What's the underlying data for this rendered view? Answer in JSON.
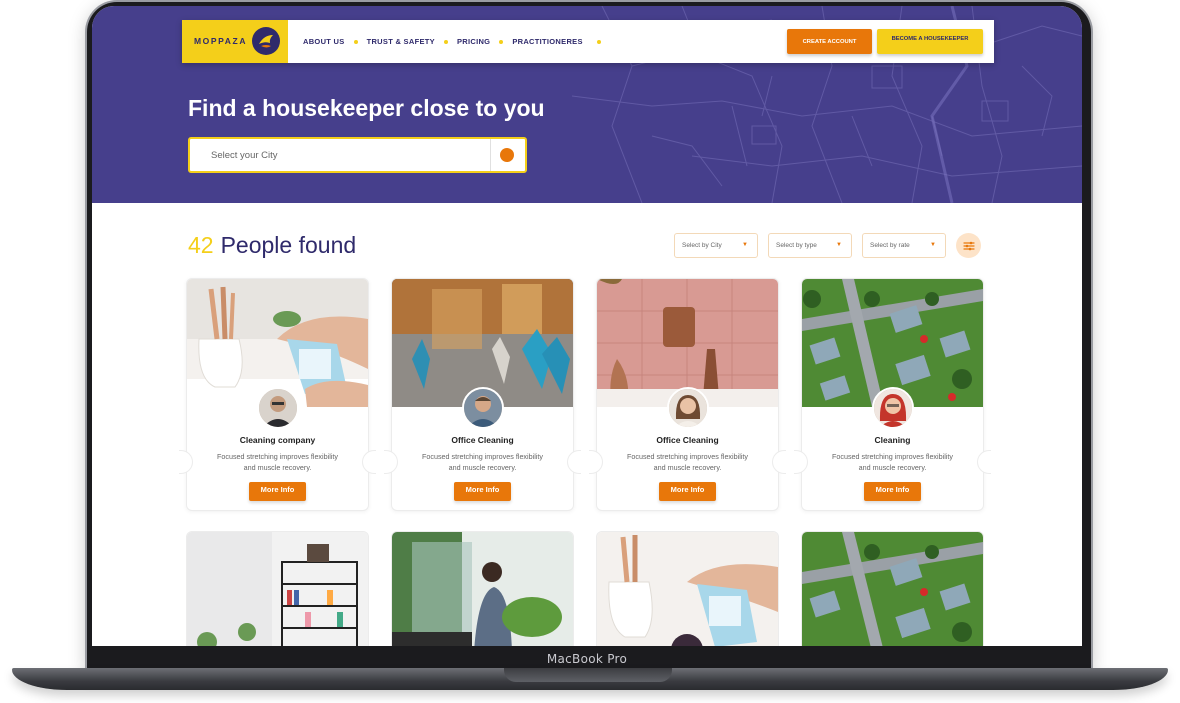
{
  "device": {
    "label": "MacBook Pro"
  },
  "header": {
    "logo_text": "MOPPAZA",
    "nav": [
      "ABOUT US",
      "TRUST & SAFETY",
      "PRICING",
      "PRACTITIONERES"
    ],
    "create_account": "CREATE ACCOUNT",
    "become_housekeeper": "BECOME A HOUSEKEEPER"
  },
  "hero": {
    "title": "Find a housekeeper close to you",
    "search_placeholder": "Select your City"
  },
  "results": {
    "count": "42",
    "label": "People found",
    "filters": [
      "Select by City",
      "Select by type",
      "Select by rate"
    ]
  },
  "cards": [
    {
      "title": "Cleaning company",
      "description": "Focused stretching improves flexibility and muscle recovery.",
      "button": "More Info"
    },
    {
      "title": "Office Cleaning",
      "description": "Focused stretching improves flexibility and muscle recovery.",
      "button": "More Info"
    },
    {
      "title": "Office Cleaning",
      "description": "Focused stretching improves flexibility and muscle recovery.",
      "button": "More Info"
    },
    {
      "title": "Cleaning",
      "description": "Focused stretching improves flexibility and muscle recovery.",
      "button": "More Info"
    }
  ],
  "colors": {
    "brand_purple": "#463f8c",
    "brand_yellow": "#f4cf1a",
    "brand_orange": "#e8770a"
  }
}
